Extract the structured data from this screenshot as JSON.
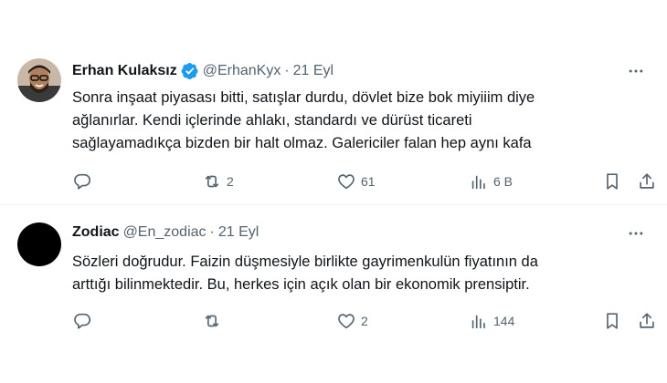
{
  "tweets": [
    {
      "author_name": "Erhan Kulaksız",
      "handle": "@ErhanKyx",
      "separator": "·",
      "date": "21 Eyl",
      "verified": true,
      "text_lines": [
        "Sonra inşaat piyasası bitti, satışlar durdu, dövlet bize bok miyiiim diye",
        "ağlanırlar. Kendi içlerinde ahlakı, standardı ve dürüst ticareti",
        "sağlayamadıkça bizden bir halt olmaz. Galericiler falan hep aynı kafa"
      ],
      "replies": "",
      "retweets": "2",
      "likes": "61",
      "views": "6 B"
    },
    {
      "author_name": "Zodiac",
      "handle": "@En_zodiac",
      "separator": "·",
      "date": "21 Eyl",
      "verified": false,
      "text_lines": [
        "Sözleri doğrudur. Faizin düşmesiyle birlikte gayrimenkulün fiyatının da",
        "arttığı bilinmektedir. Bu, herkes için açık olan bir ekonomik prensiptir."
      ],
      "replies": "",
      "retweets": "",
      "likes": "2",
      "views": "144"
    }
  ],
  "colors": {
    "text_primary": "#0f1419",
    "text_secondary": "#536471",
    "verified_blue": "#1d9bf0",
    "divider": "#eff3f4"
  },
  "icons": [
    "verified-badge-icon",
    "more-options-icon",
    "reply-icon",
    "retweet-icon",
    "like-icon",
    "views-icon",
    "bookmark-icon",
    "share-icon"
  ]
}
